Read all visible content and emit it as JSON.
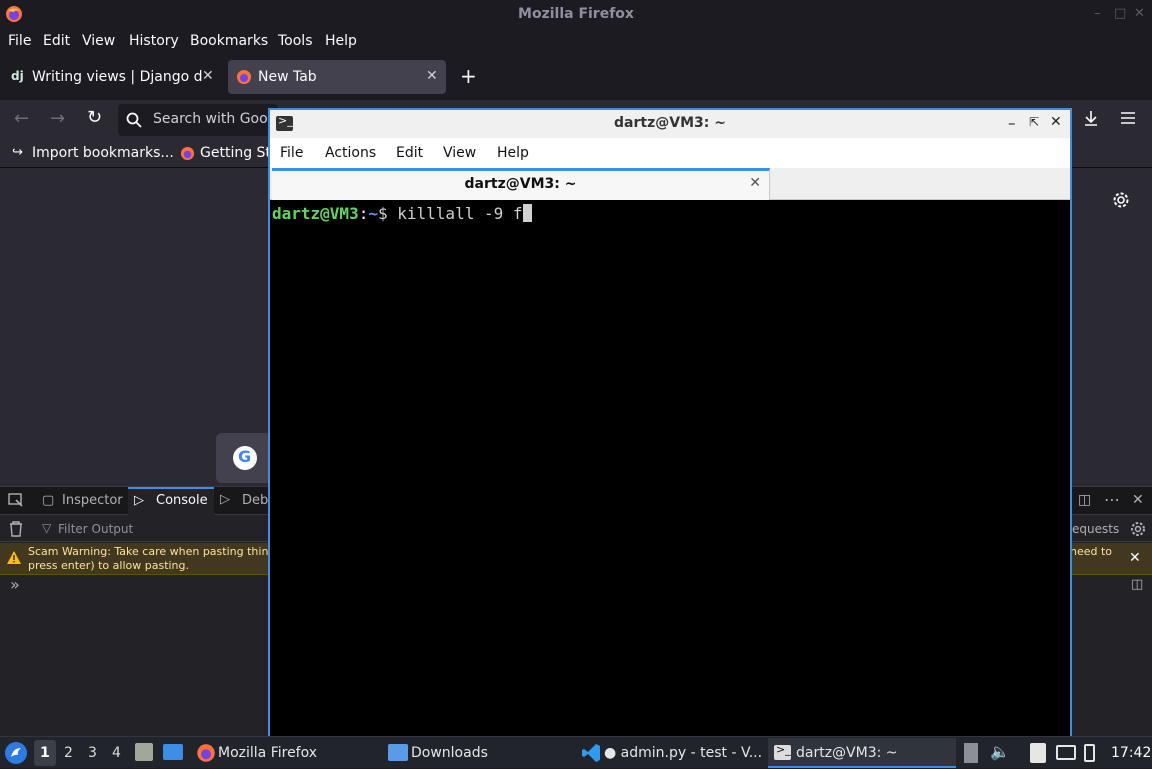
{
  "firefox": {
    "window_title": "Mozilla Firefox",
    "menu": [
      "File",
      "Edit",
      "View",
      "History",
      "Bookmarks",
      "Tools",
      "Help"
    ],
    "tabs": [
      {
        "icon": "dj",
        "label": "Writing views | Django do"
      },
      {
        "label": "New Tab"
      }
    ],
    "search_placeholder": "Search with Goo",
    "bookmarks": [
      {
        "label": "Import bookmarks..."
      },
      {
        "label": "Getting St"
      }
    ]
  },
  "devtools": {
    "tabs": [
      "Inspector",
      "Console",
      "Deb"
    ],
    "filter_placeholder": "Filter Output",
    "requests_label": "equests",
    "warning_line1": "Scam Warning: Take care when pasting thin",
    "warning_line2": "press enter) to allow pasting.",
    "warning_right": "need to",
    "prompt": "»"
  },
  "terminal": {
    "window_title": "dartz@VM3: ~",
    "menu": [
      "File",
      "Actions",
      "Edit",
      "View",
      "Help"
    ],
    "tab_label": "dartz@VM3: ~",
    "prompt_user": "dartz@VM3",
    "prompt_sep": ":",
    "prompt_path": "~",
    "prompt_sym": "$",
    "command": "killlall -9 f"
  },
  "taskbar": {
    "workspaces": [
      "1",
      "2",
      "3",
      "4"
    ],
    "tasks": [
      {
        "label": "Mozilla Firefox"
      },
      {
        "label": "Downloads"
      },
      {
        "label": "● admin.py - test - V..."
      },
      {
        "label": "dartz@VM3: ~"
      }
    ],
    "clock": "17:42"
  },
  "colors": {
    "accent": "#3d8ee6",
    "prompt_green": "#5fd75f",
    "prompt_blue": "#6c8ef5"
  }
}
